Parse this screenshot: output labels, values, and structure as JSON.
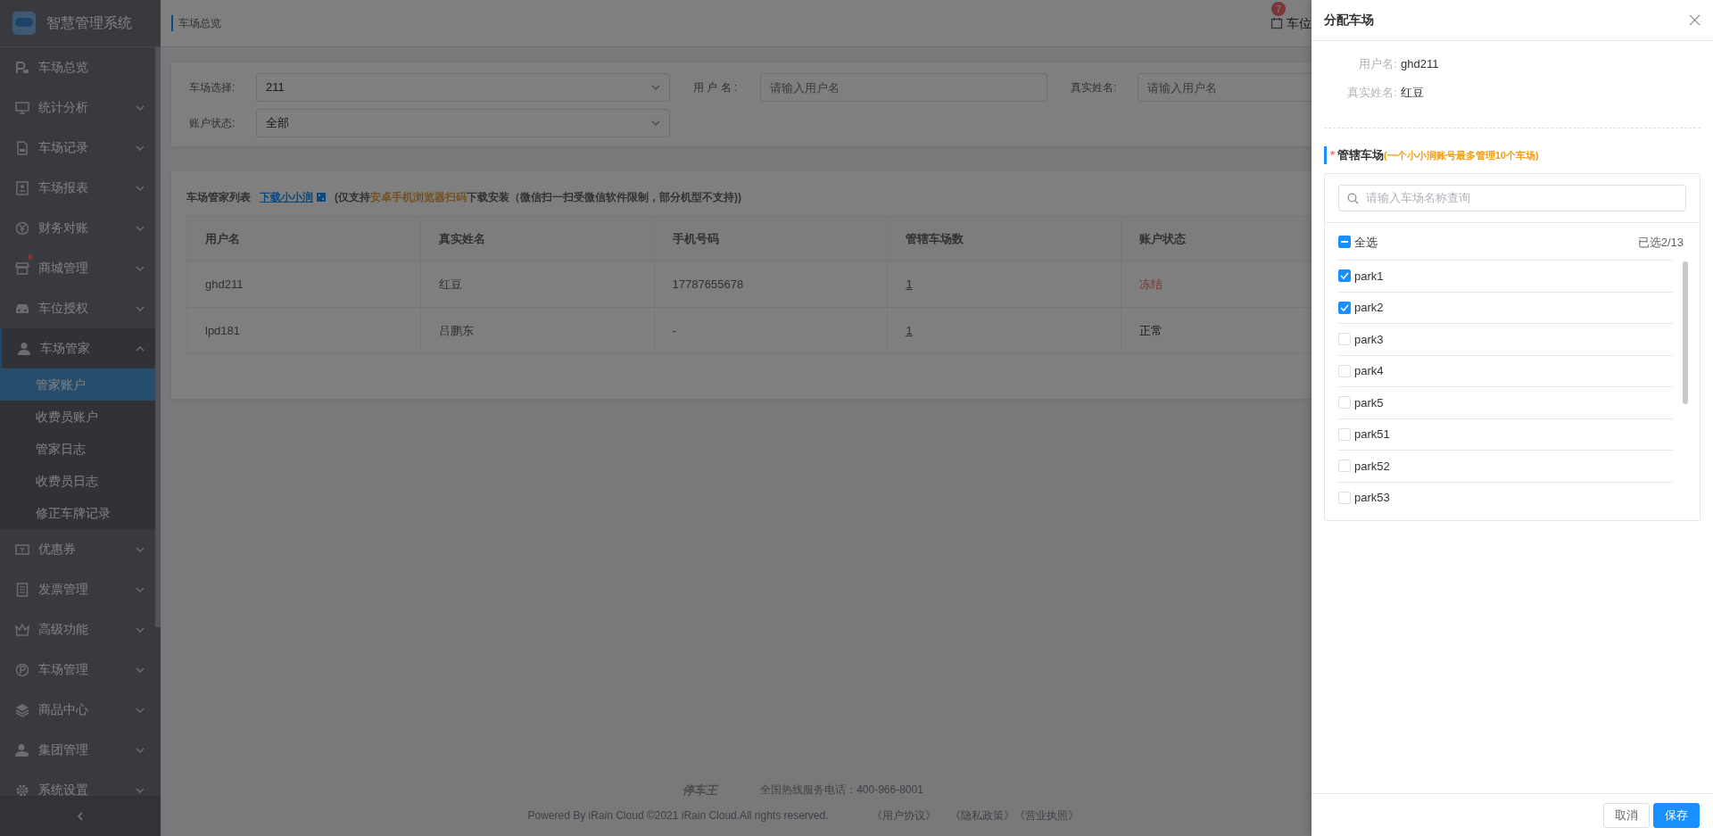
{
  "sidebar": {
    "title": "智慧管理系统",
    "items": [
      {
        "label": "车场总览",
        "expandable": false,
        "expanded": false,
        "dot": false
      },
      {
        "label": "统计分析",
        "expandable": true,
        "expanded": false,
        "dot": false
      },
      {
        "label": "车场记录",
        "expandable": true,
        "expanded": false,
        "dot": false
      },
      {
        "label": "车场报表",
        "expandable": true,
        "expanded": false,
        "dot": false
      },
      {
        "label": "财务对账",
        "expandable": true,
        "expanded": false,
        "dot": false
      },
      {
        "label": "商城管理",
        "expandable": true,
        "expanded": false,
        "dot": true
      },
      {
        "label": "车位授权",
        "expandable": true,
        "expanded": false,
        "dot": false
      },
      {
        "label": "车场管家",
        "expandable": true,
        "expanded": true,
        "dot": false,
        "children": [
          {
            "label": "管家账户",
            "selected": true
          },
          {
            "label": "收费员账户",
            "selected": false
          },
          {
            "label": "管家日志",
            "selected": false
          },
          {
            "label": "收费员日志",
            "selected": false
          },
          {
            "label": "修正车牌记录",
            "selected": false
          }
        ]
      },
      {
        "label": "优惠券",
        "expandable": true,
        "expanded": false,
        "dot": false
      },
      {
        "label": "发票管理",
        "expandable": true,
        "expanded": false,
        "dot": false
      },
      {
        "label": "高级功能",
        "expandable": true,
        "expanded": false,
        "dot": false
      },
      {
        "label": "车场管理",
        "expandable": true,
        "expanded": false,
        "dot": false
      },
      {
        "label": "商品中心",
        "expandable": true,
        "expanded": false,
        "dot": false
      },
      {
        "label": "集团管理",
        "expandable": true,
        "expanded": false,
        "dot": false
      },
      {
        "label": "系统设置",
        "expandable": true,
        "expanded": false,
        "dot": false
      }
    ]
  },
  "header": {
    "breadcrumb": "车场总览",
    "badge": "7",
    "link": "车位"
  },
  "filters": [
    {
      "label": "车场选择:",
      "kind": "select",
      "value": "211"
    },
    {
      "label": "用 户 名 :",
      "kind": "input",
      "placeholder": "请输入用户名"
    },
    {
      "label": "真实姓名:",
      "kind": "input",
      "placeholder": "请输入用户名"
    },
    {
      "label": "账户状态:",
      "kind": "select",
      "value": "全部"
    }
  ],
  "list": {
    "title": "车场管家列表",
    "download_link": "下载小小润",
    "note": "(仅支持**安卓手机浏览器扫码**下载安装（微信扫一扫受微信软件限制，部分机型不支持))",
    "table": {
      "columns": [
        "用户名",
        "真实姓名",
        "手机号码",
        "管辖车场数",
        "账户状态"
      ],
      "rows": [
        {
          "cells": [
            "ghd211",
            "红豆",
            "17787655678",
            "1",
            "冻结"
          ],
          "frozen": true
        },
        {
          "cells": [
            "lpd181",
            "吕鹏东",
            "-",
            "1",
            "正常"
          ],
          "frozen": false
        }
      ]
    }
  },
  "footer": {
    "brand": "停车王",
    "hotline": "全国热线服务电话：400-966-8001",
    "copyright": "Powered By iRain Cloud ©2021 iRain Cloud.All rights reserved.",
    "links": [
      "《用户协议》",
      "《隐私政策》",
      "《营业执照》"
    ]
  },
  "drawer": {
    "title": "分配车场",
    "info": [
      {
        "label": "用户名:",
        "value": "ghd211"
      },
      {
        "label": "真实姓名:",
        "value": "红豆"
      }
    ],
    "required_mark": "*",
    "section_title": "管辖车场",
    "section_note": "(一个小小润账号最多管理10个车场)",
    "search": {
      "placeholder": "请输入车场名称查询"
    },
    "select_all": {
      "label": "全选",
      "indeterminate": true
    },
    "count": "已选2/13",
    "parks": [
      {
        "label": "park1",
        "checked": true
      },
      {
        "label": "park2",
        "checked": true
      },
      {
        "label": "park3",
        "checked": false
      },
      {
        "label": "park4",
        "checked": false
      },
      {
        "label": "park5",
        "checked": false
      },
      {
        "label": "park51",
        "checked": false
      },
      {
        "label": "park52",
        "checked": false
      },
      {
        "label": "park53",
        "checked": false
      }
    ],
    "buttons": [
      {
        "label": "取消",
        "kind": "secondary"
      },
      {
        "label": "保存",
        "kind": "primary"
      }
    ]
  }
}
